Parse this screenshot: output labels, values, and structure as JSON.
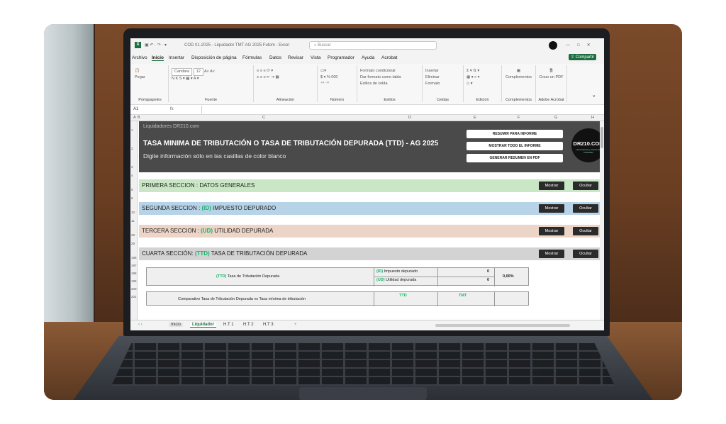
{
  "window": {
    "file_title": "COD 01-2025 - Liquidador TMT AG 2025 Futom - Excel",
    "search_placeholder": "Buscar",
    "share_label": "Compartir"
  },
  "menu": [
    "Archivo",
    "Inicio",
    "Insertar",
    "Disposición de página",
    "Fórmulas",
    "Datos",
    "Revisar",
    "Vista",
    "Programador",
    "Ayuda",
    "Acrobat"
  ],
  "ribbon": {
    "paste_label": "Pegar",
    "clipboard_label": "Portapapeles",
    "font_name": "Candara",
    "font_size": "12",
    "font_label": "Fuente",
    "alignment_label": "Alineación",
    "number_label": "Número",
    "styles": [
      "Formato condicional",
      "Dar formato como tabla",
      "Estilos de celda"
    ],
    "styles_label": "Estilos",
    "cells": [
      "Insertar",
      "Eliminar",
      "Formato"
    ],
    "cells_label": "Celdas",
    "editing_label": "Edición",
    "addins_btn": "Complementos",
    "addins_label": "Complementos",
    "pdf_btn": "Crear un PDF",
    "pdf_label": "Adobe Acrobat"
  },
  "formula_bar": {
    "name_box": "A1",
    "fx": "fx"
  },
  "columns": [
    "A",
    "B",
    "C",
    "D",
    "E",
    "F",
    "G",
    "H"
  ],
  "rows": [
    "1",
    "2",
    "3",
    "4",
    "5",
    "6",
    "10",
    "11",
    "28",
    "29",
    "196",
    "197",
    "198",
    "199",
    "200",
    "201"
  ],
  "sheet": {
    "site": "Liquidadores DR210.com",
    "title": "TASA MINIMA DE TRIBUTACIÓN O TASA DE TRIBUTACIÓN DEPURADA (TTD) - AG 2025",
    "subtitle": "Digite información sólo en las casillas de color blanco",
    "btn_resumir": "RESUMIR PARA INFORME",
    "btn_mostrar_todo": "MOSTRAR TODO EL INFORME",
    "btn_generar": "GENERAR RESUMEN EN PDF",
    "brand": "DR210.COM",
    "brand_tag": "Herramientas y soluciones tributarias",
    "sections": [
      {
        "pre": "PRIMERA SECCION : DATOS GENERALES",
        "hl": "",
        "post": "",
        "color": "#c9e7c4"
      },
      {
        "pre": "SEGUNDA SECCION : ",
        "hl": "(ID)",
        "post": " IMPUESTO DEPURADO",
        "color": "#b7d3e8"
      },
      {
        "pre": "TERCERA SECCION : ",
        "hl": "(UD)",
        "post": " UTILIDAD DEPURADA",
        "color": "#ecd4c6"
      },
      {
        "pre": "CUARTA SECCIÓN: ",
        "hl": "(TTD)",
        "post": " TASA DE TRIBUTACIÓN DEPURADA",
        "color": "#d3d3d3"
      }
    ],
    "show_label": "Mostrar",
    "hide_label": "Ocultar",
    "ttd_hl": "(TTD)",
    "ttd_label": "Tasa de Tributación Depurada",
    "id_hl": "(ID)",
    "id_label": "Impuesto depurado",
    "ud_hl": "(UD)",
    "ud_label": "Utilidad depurada",
    "id_value": "0",
    "ud_value": "0",
    "ttd_value": "0,00%",
    "compare_label": "Comparativo Tasa de Tributación Depurada vs Tasa mínima de tributación",
    "col_ttd": "TTD",
    "col_tmt": "TMT"
  },
  "tabs": [
    "Inicio",
    "Liquidador",
    "H.T 1",
    "H.T 2",
    "H.T 3",
    "+"
  ],
  "colors": {
    "excel_green": "#1d6f42",
    "highlight": "#17b26a"
  }
}
